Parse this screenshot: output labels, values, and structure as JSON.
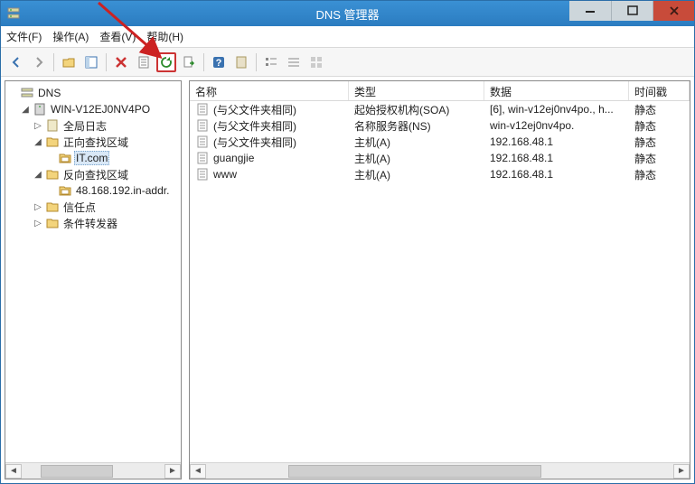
{
  "window": {
    "title": "DNS 管理器"
  },
  "menu": {
    "file": "文件(F)",
    "action": "操作(A)",
    "view": "查看(V)",
    "help": "帮助(H)"
  },
  "tree": {
    "root": "DNS",
    "server": "WIN-V12EJ0NV4PO",
    "global_log": "全局日志",
    "fwd_zone": "正向查找区域",
    "zone_it": "IT.com",
    "rev_zone": "反向查找区域",
    "rev_item": "48.168.192.in-addr.",
    "trust": "信任点",
    "cond_fwd": "条件转发器"
  },
  "columns": {
    "name": "名称",
    "type": "类型",
    "data": "数据",
    "ts": "时间戳"
  },
  "records": [
    {
      "name": "(与父文件夹相同)",
      "type": "起始授权机构(SOA)",
      "data": "[6], win-v12ej0nv4po., h...",
      "ts": "静态"
    },
    {
      "name": "(与父文件夹相同)",
      "type": "名称服务器(NS)",
      "data": "win-v12ej0nv4po.",
      "ts": "静态"
    },
    {
      "name": "(与父文件夹相同)",
      "type": "主机(A)",
      "data": "192.168.48.1",
      "ts": "静态"
    },
    {
      "name": "guangjie",
      "type": "主机(A)",
      "data": "192.168.48.1",
      "ts": "静态"
    },
    {
      "name": "www",
      "type": "主机(A)",
      "data": "192.168.48.1",
      "ts": "静态"
    }
  ]
}
